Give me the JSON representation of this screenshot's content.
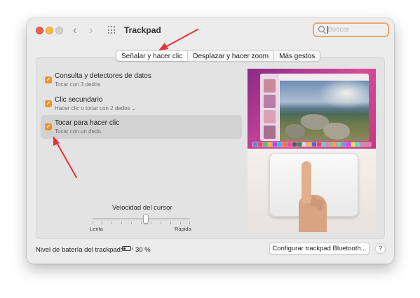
{
  "window": {
    "title": "Trackpad",
    "nav_back": "‹",
    "nav_forward": "›"
  },
  "search": {
    "placeholder": "Buscar",
    "value": ""
  },
  "tabs": [
    {
      "label": "Señalar y hacer clic",
      "selected": true
    },
    {
      "label": "Desplazar y hacer zoom",
      "selected": false
    },
    {
      "label": "Más gestos",
      "selected": false
    }
  ],
  "options": [
    {
      "title": "Consulta y detectores de datos",
      "subtitle": "Tocar con 3 dedos",
      "checked": true,
      "has_menu": false,
      "selected": false
    },
    {
      "title": "Clic secundario",
      "subtitle": "Hacer clic o tocar con 2 dedos",
      "checked": true,
      "has_menu": true,
      "selected": false
    },
    {
      "title": "Tocar para hacer clic",
      "subtitle": "Tocar con un dedo",
      "checked": true,
      "has_menu": false,
      "selected": true
    }
  ],
  "cursor_speed": {
    "label": "Velocidad del cursor",
    "min_label": "Lenta",
    "max_label": "Rápida",
    "level": 0.52
  },
  "footer": {
    "battery_label": "Nivel de batería del trackpad:",
    "battery_percent": "30 %",
    "battery_level": 0.3,
    "bluetooth_button": "Configurar trackpad Bluetooth...",
    "help_button": "?"
  },
  "colors": {
    "accent": "#f0902a",
    "search_focus": "#e8a871",
    "annotation_arrow": "#e8303a"
  },
  "icons": {
    "grid": "grid-icon",
    "search": "search-icon",
    "battery": "battery-icon",
    "checkbox": "checkmark-icon"
  }
}
